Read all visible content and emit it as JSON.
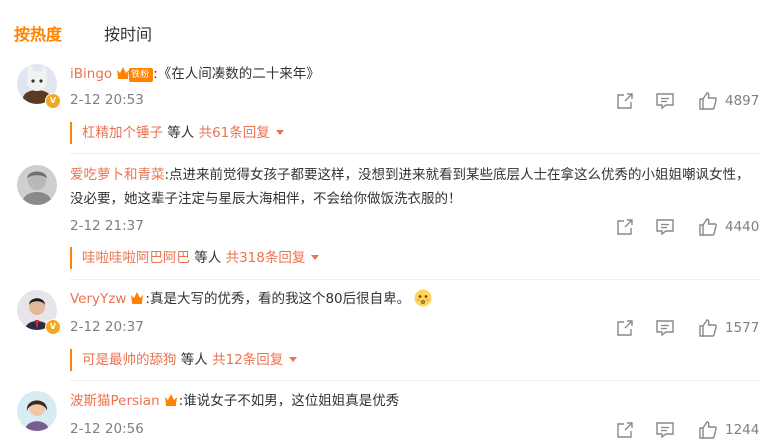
{
  "tabs": {
    "hot": "按热度",
    "time": "按时间"
  },
  "colors": {
    "accent": "#ff8200",
    "username": "#eb7350",
    "muted": "#808080"
  },
  "comments": [
    {
      "username": "iBingo",
      "badge": "铁粉",
      "text": ":《在人间凑数的二十来年》",
      "time": "2-12 20:53",
      "likes": "4897",
      "reply_name": "杠精加个锤子",
      "reply_mid": " 等人 ",
      "reply_count": "共61条回复"
    },
    {
      "username": "爱吃萝卜和青菜",
      "text": ":点进来前觉得女孩子都要这样，没想到进来就看到某些底层人士在拿这么优秀的小姐姐嘲讽女性，没必要，她这辈子注定与星辰大海相伴，不会给你做饭洗衣服的！",
      "time": "2-12 21:37",
      "likes": "4440",
      "reply_name": "哇啦哇啦阿巴阿巴",
      "reply_mid": " 等人 ",
      "reply_count": "共318条回复"
    },
    {
      "username": "VeryYzw",
      "text": ":真是大写的优秀，看的我这个80后很自卑。",
      "time": "2-12 20:37",
      "likes": "1577",
      "reply_name": "可是最帅的舔狗",
      "reply_mid": " 等人 ",
      "reply_count": "共12条回复"
    },
    {
      "username": "波斯猫Persian",
      "text": ":谁说女子不如男，这位姐姐真是优秀",
      "time": "2-12 20:56",
      "likes": "1244"
    }
  ]
}
